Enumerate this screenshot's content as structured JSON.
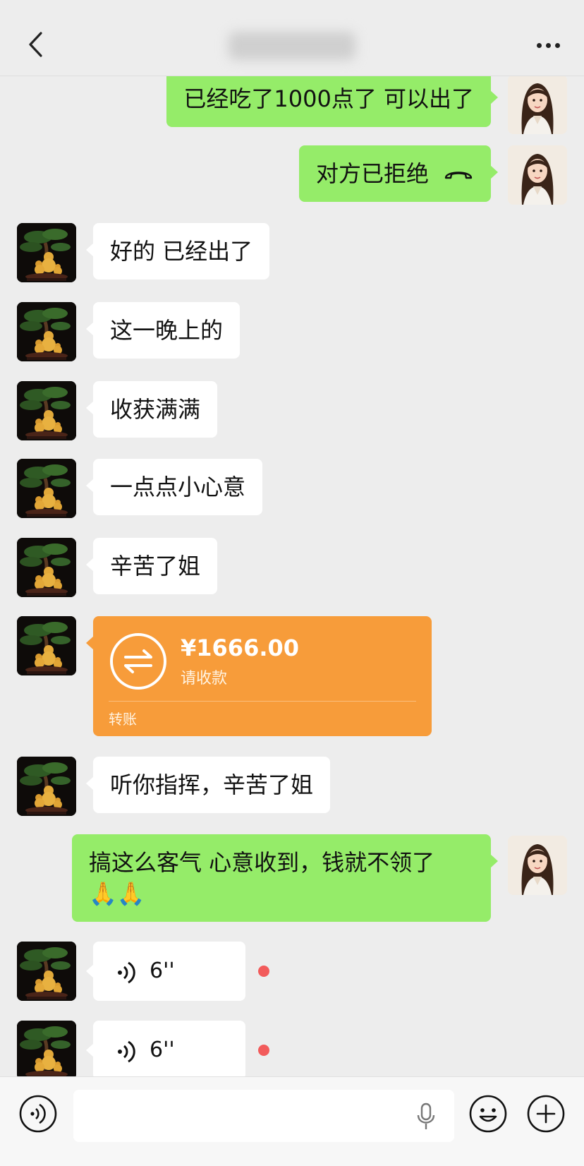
{
  "header": {
    "title": "",
    "back_icon": "chevron-left-icon",
    "more_icon": "more-dots-icon"
  },
  "messages": [
    {
      "side": "right",
      "type": "text",
      "text": "已经吃了1000点了 可以出了"
    },
    {
      "side": "right",
      "type": "call",
      "text": "对方已拒绝",
      "icon": "call-declined-icon"
    },
    {
      "side": "left",
      "type": "text",
      "text": "好的 已经出了"
    },
    {
      "side": "left",
      "type": "text",
      "text": "这一晚上的"
    },
    {
      "side": "left",
      "type": "text",
      "text": "收获满满"
    },
    {
      "side": "left",
      "type": "text",
      "text": "一点点小心意"
    },
    {
      "side": "left",
      "type": "text",
      "text": "辛苦了姐"
    },
    {
      "side": "left",
      "type": "transfer",
      "amount": "¥1666.00",
      "status": "请收款",
      "label": "转账"
    },
    {
      "side": "left",
      "type": "text",
      "text": "听你指挥，辛苦了姐"
    },
    {
      "side": "right",
      "type": "text",
      "text": "搞这么客气  心意收到，钱就不领了",
      "emoji": "🙏🙏"
    },
    {
      "side": "left",
      "type": "voice",
      "duration": "6''",
      "unread": true
    },
    {
      "side": "left",
      "type": "voice",
      "duration": "6''",
      "unread": true
    }
  ],
  "input_bar": {
    "placeholder": "",
    "voice_icon": "voice-mode-icon",
    "mic_icon": "microphone-icon",
    "emoji_icon": "emoji-icon",
    "plus_icon": "plus-icon"
  },
  "colors": {
    "background": "#ededed",
    "self_bubble": "#95ec69",
    "other_bubble": "#ffffff",
    "transfer": "#f79c3a",
    "unread_dot": "#f25b5b"
  }
}
